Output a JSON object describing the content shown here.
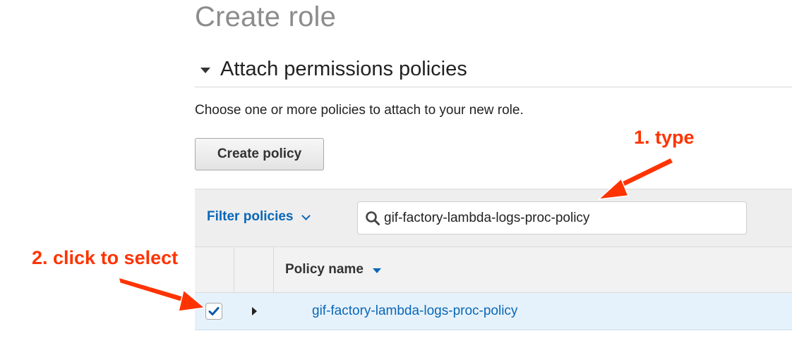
{
  "page": {
    "title": "Create role"
  },
  "section": {
    "title": "Attach permissions policies",
    "description": "Choose one or more policies to attach to your new role."
  },
  "toolbar": {
    "create_policy_label": "Create policy"
  },
  "filter": {
    "label": "Filter policies",
    "search_value": "gif-factory-lambda-logs-proc-policy"
  },
  "table": {
    "columns": [
      "Policy name"
    ],
    "rows": [
      {
        "policy_name": "gif-factory-lambda-logs-proc-policy",
        "selected": true
      }
    ]
  },
  "annotations": {
    "step1": "1. type",
    "step2": "2. click to select",
    "color": "#ff3300"
  },
  "colors": {
    "link": "#0a67b7",
    "selected_row": "#e6f2fb",
    "filter_bar": "#eeeeee"
  }
}
